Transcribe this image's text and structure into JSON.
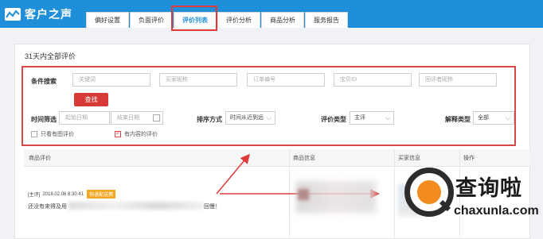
{
  "app": {
    "title": "客户之声"
  },
  "tabs": [
    "偏好设置",
    "负面评价",
    "评价列表",
    "评价分析",
    "商品分析",
    "服务报告"
  ],
  "active_tab_index": 2,
  "content": {
    "title": "31天内全部评价"
  },
  "filters": {
    "search_label": "条件搜索",
    "keyword_placeholder": "关键词",
    "buyer_nick_placeholder": "买家昵称",
    "order_no_placeholder": "订单编号",
    "sku_placeholder": "宝贝ID",
    "reply_nick_placeholder": "回评者昵称",
    "search_button": "查找",
    "time_label": "时间筛选",
    "start_date_placeholder": "起始日期",
    "end_date_placeholder": "结束日期",
    "sort_label": "排序方式",
    "sort_value": "时间从近到远",
    "type_label": "评价类型",
    "type_value": "主评",
    "rating_label": "解释类型",
    "rating_value": "全部",
    "only_image_label": "只看有图评价",
    "only_image_checked": false,
    "has_content_label": "有内容的评价",
    "has_content_checked": true
  },
  "table": {
    "headers": [
      "商品评价",
      "商品信息",
      "买家信息",
      "操作"
    ],
    "rows": [
      {
        "type": "[主评]",
        "date": "2018.02.06 8:30:41",
        "tag": "快递配送费",
        "text": "还没有来得及用",
        "text_tail": "回慢！"
      }
    ]
  },
  "watermark": {
    "cn": "查询啦",
    "en": "chaxunla.com"
  },
  "colors": {
    "brand": "#1e8fd8",
    "highlight": "#e03a3a",
    "button": "#d63a36",
    "tag": "#f5a623"
  }
}
